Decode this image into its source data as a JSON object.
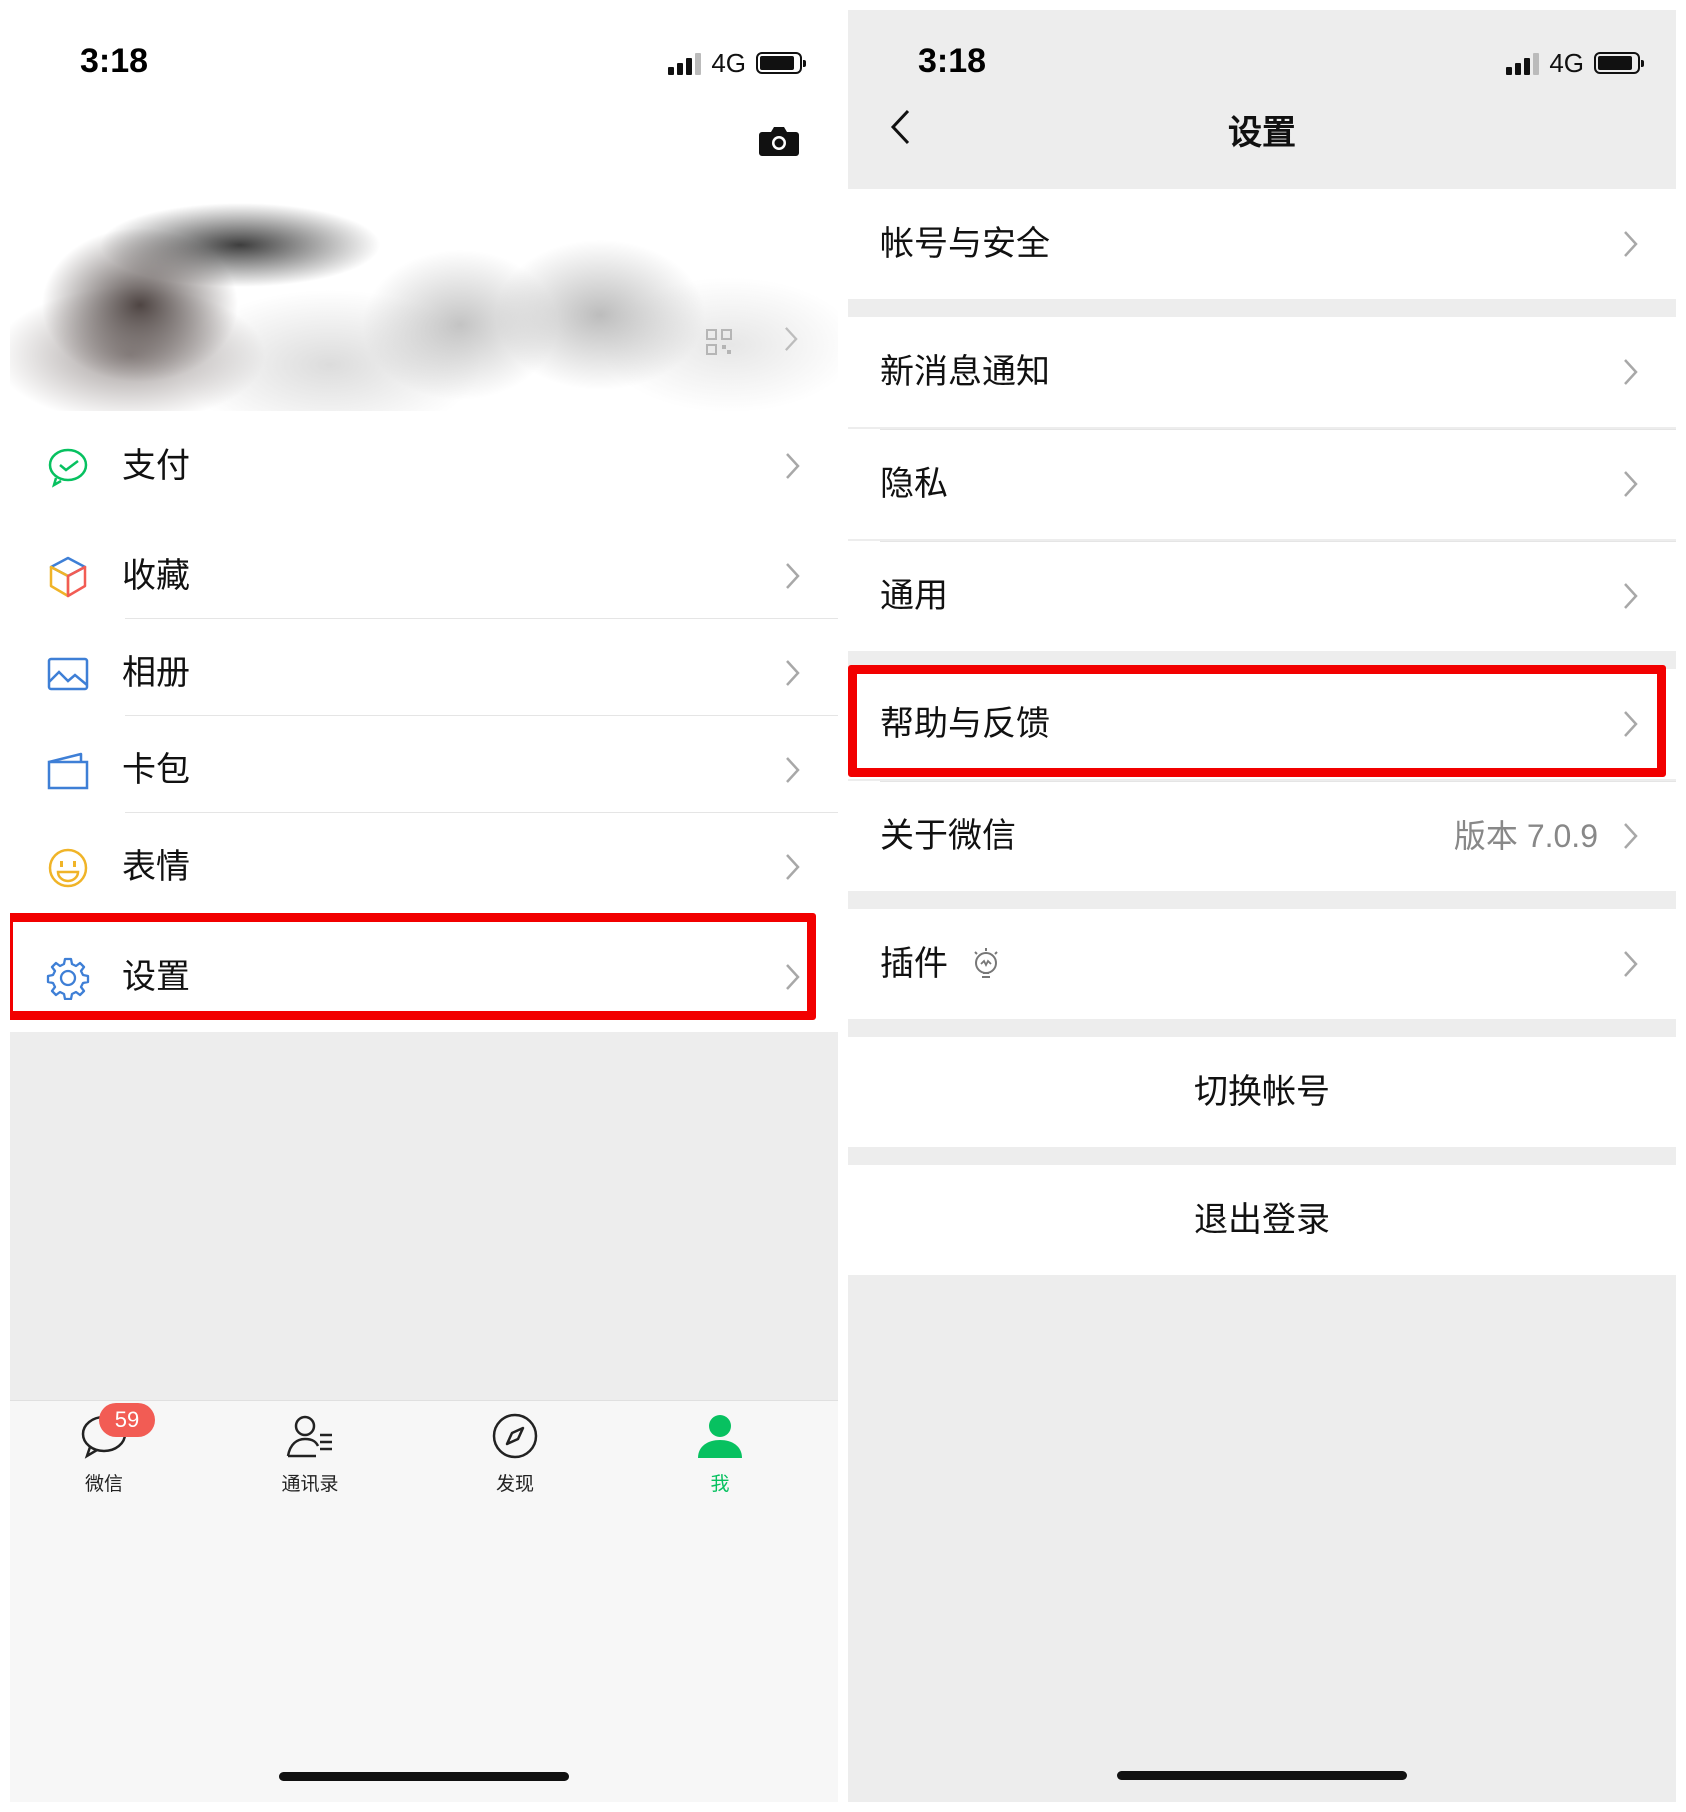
{
  "left_screen": {
    "status": {
      "time": "3:18",
      "network": "4G"
    },
    "profile": {},
    "menu": [
      {
        "id": "pay",
        "label": "支付",
        "icon": "wechat-pay-icon"
      },
      {
        "id": "favorites",
        "label": "收藏",
        "icon": "cube-icon"
      },
      {
        "id": "album",
        "label": "相册",
        "icon": "image-icon"
      },
      {
        "id": "cards",
        "label": "卡包",
        "icon": "wallet-icon"
      },
      {
        "id": "stickers",
        "label": "表情",
        "icon": "smiley-icon"
      },
      {
        "id": "settings",
        "label": "设置",
        "icon": "gear-icon",
        "highlighted": true
      }
    ],
    "tabbar": {
      "chats": {
        "label": "微信",
        "badge": "59"
      },
      "contacts": {
        "label": "通讯录"
      },
      "discover": {
        "label": "发现"
      },
      "me": {
        "label": "我",
        "active": true
      }
    }
  },
  "right_screen": {
    "status": {
      "time": "3:18",
      "network": "4G"
    },
    "title": "设置",
    "items": [
      {
        "id": "account",
        "label": "帐号与安全"
      },
      {
        "id": "notifications",
        "label": "新消息通知"
      },
      {
        "id": "privacy",
        "label": "隐私"
      },
      {
        "id": "general",
        "label": "通用"
      },
      {
        "id": "help",
        "label": "帮助与反馈",
        "highlighted": true
      },
      {
        "id": "about",
        "label": "关于微信",
        "value": "版本 7.0.9"
      },
      {
        "id": "plugins",
        "label": "插件",
        "icon": "plugin-bulb-icon"
      },
      {
        "id": "switch_account",
        "label": "切换帐号"
      },
      {
        "id": "logout",
        "label": "退出登录"
      }
    ]
  },
  "colors": {
    "accent_green": "#07c160",
    "highlight_red": "#f20000",
    "badge_red": "#f25c54",
    "icon_blue": "#3e7fd6",
    "icon_yellow": "#f0b428"
  }
}
